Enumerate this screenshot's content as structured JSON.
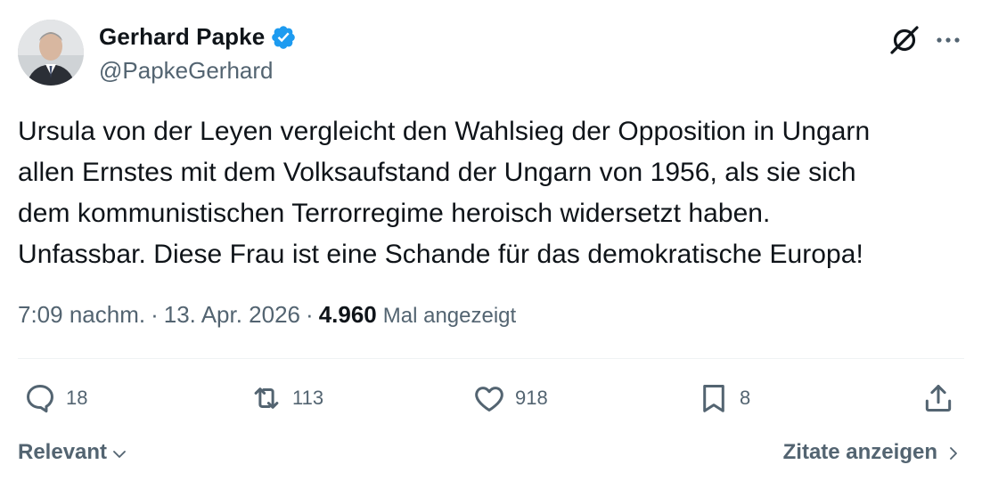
{
  "author": {
    "name": "Gerhard Papke",
    "handle": "@PapkeGerhard",
    "verified": true
  },
  "tweet": {
    "lines": [
      "Ursula von der Leyen vergleicht den Wahlsieg der Opposition in Ungarn",
      "allen Ernstes mit dem Volksaufstand der Ungarn von 1956, als sie sich",
      "dem kommunistischen Terrorregime heroisch widersetzt haben.",
      "Unfassbar. Diese Frau ist eine Schande für das demokratische Europa!"
    ]
  },
  "meta": {
    "time": "7:09 nachm.",
    "separator": "·",
    "date": "13. Apr. 2026",
    "views_count": "4.960",
    "views_label": "Mal angezeigt"
  },
  "actions": {
    "replies": "18",
    "reposts": "113",
    "likes": "918",
    "bookmarks": "8"
  },
  "footer": {
    "sort_label": "Relevant",
    "quotes_label": "Zitate anzeigen"
  },
  "colors": {
    "text": "#0f1419",
    "secondary": "#536471",
    "verified_blue": "#1d9bf0",
    "divider": "#eff3f4"
  },
  "icons": [
    "verified-badge-icon",
    "grok-icon",
    "more-icon",
    "reply-icon",
    "repost-icon",
    "like-icon",
    "bookmark-icon",
    "share-icon",
    "chevron-down-icon",
    "chevron-right-icon"
  ]
}
